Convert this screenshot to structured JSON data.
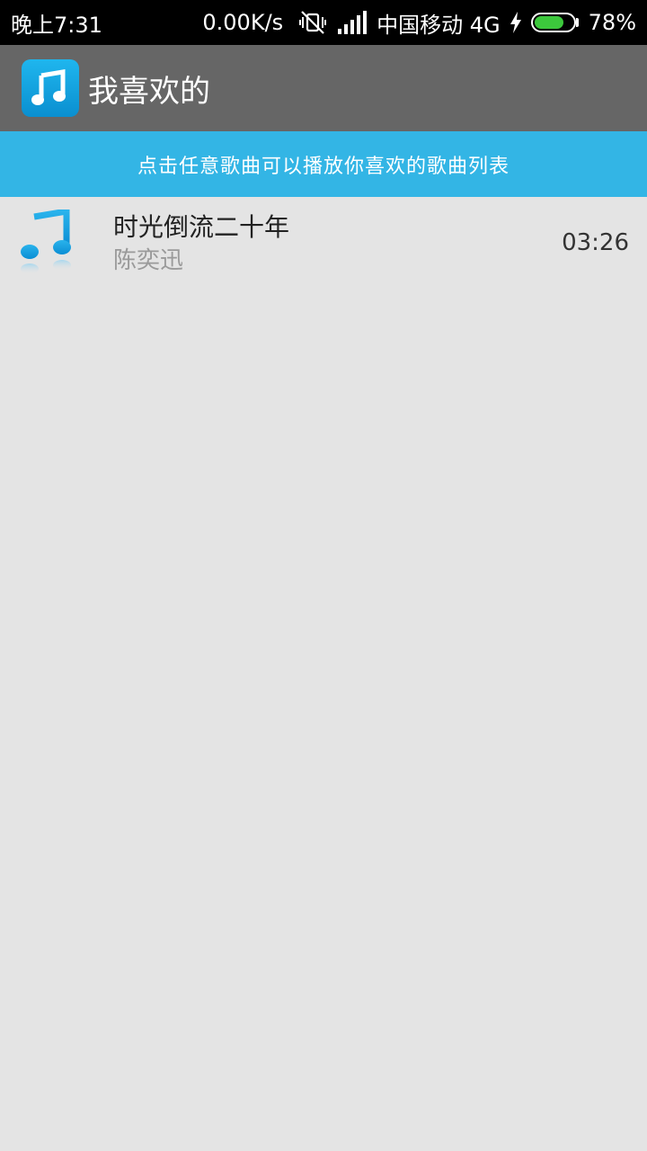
{
  "status_bar": {
    "time": "晚上7:31",
    "net_speed": "0.00K/s",
    "carrier": "中国移动 4G",
    "battery_pct": "78%",
    "battery_level": 0.78,
    "battery_color": "#3cc83c"
  },
  "app_bar": {
    "title": "我喜欢的",
    "logo_icon": "music-note-icon",
    "bg_color": "#666666"
  },
  "banner": {
    "text": "点击任意歌曲可以播放你喜欢的歌曲列表",
    "bg_color": "#33b5e5"
  },
  "songs": [
    {
      "title": "时光倒流二十年",
      "artist": "陈奕迅",
      "duration": "03:26",
      "icon": "music-note-icon"
    }
  ]
}
